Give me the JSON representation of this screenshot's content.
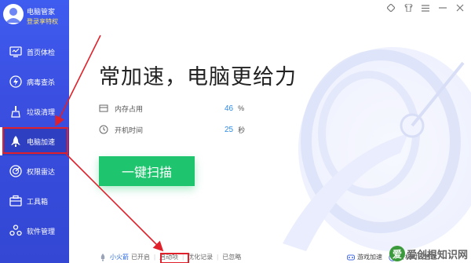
{
  "profile": {
    "name": "电脑管家",
    "login": "登录享特权"
  },
  "sidebar": {
    "items": [
      {
        "label": "首页体检",
        "icon": "monitor-check-icon",
        "active": false
      },
      {
        "label": "病毒查杀",
        "icon": "lightning-icon",
        "active": false
      },
      {
        "label": "垃圾清理",
        "icon": "broom-icon",
        "active": false
      },
      {
        "label": "电脑加速",
        "icon": "rocket-icon",
        "active": true
      },
      {
        "label": "权限雷达",
        "icon": "radar-icon",
        "active": false
      },
      {
        "label": "工具箱",
        "icon": "toolbox-icon",
        "active": false
      },
      {
        "label": "软件管理",
        "icon": "software-icon",
        "active": false
      }
    ]
  },
  "window": {
    "buttons": [
      "diamond-icon",
      "shirt-icon",
      "menu-icon",
      "minimize-icon",
      "close-icon"
    ]
  },
  "main": {
    "headline": "常加速，电脑更给力",
    "stats": [
      {
        "label": "内存占用",
        "value": "46",
        "unit": "%",
        "icon": "memory-icon"
      },
      {
        "label": "开机时间",
        "value": "25",
        "unit": "秒",
        "icon": "clock-icon"
      }
    ],
    "scan_button": "一键扫描"
  },
  "bottom": {
    "left": [
      {
        "text": "小火箭",
        "style": "blue"
      },
      {
        "text": "已开启",
        "style": "plain"
      },
      {
        "text": "启动项",
        "style": "plain"
      },
      {
        "text": "优化记录",
        "style": "plain"
      },
      {
        "text": "已忽略",
        "style": "plain"
      }
    ],
    "right": [
      {
        "text": "游戏加速",
        "icon": "game-accel-icon"
      },
      {
        "text": "开机时间管理",
        "icon": "boot-time-icon"
      }
    ]
  },
  "watermark": {
    "logo": "爱",
    "text": "爱创根知识网"
  },
  "colors": {
    "sidebar": "#3a4ee0",
    "accent_green": "#1ec56e",
    "value_blue": "#2f8be6",
    "highlight_red": "#e0202a"
  }
}
